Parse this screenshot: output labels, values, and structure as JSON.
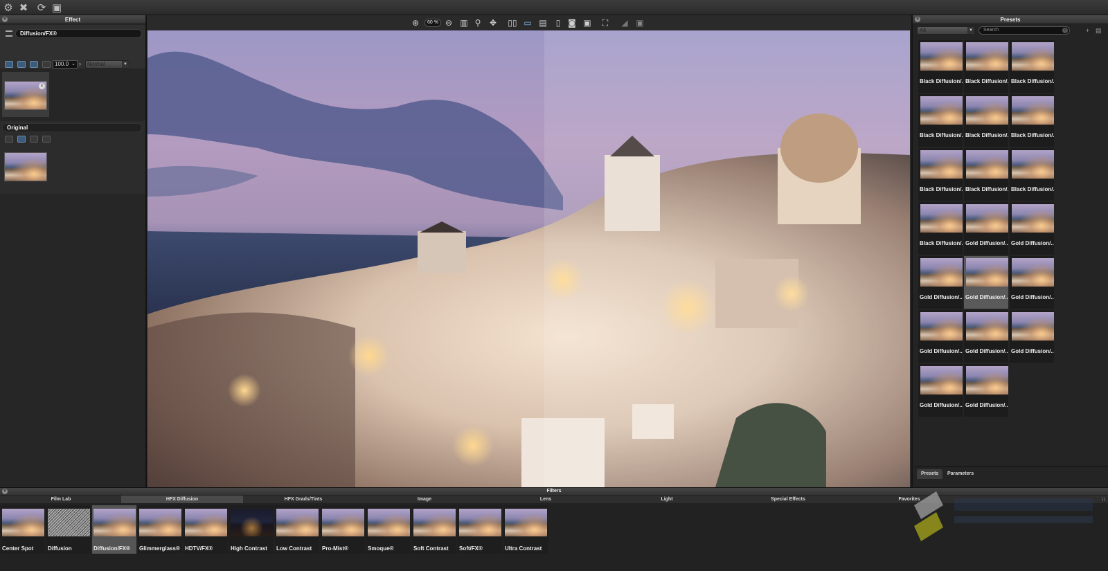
{
  "top_toolbar": {
    "icons": [
      "gear-icon",
      "close-x-icon",
      "refresh-icon",
      "frame-icon"
    ]
  },
  "left_panel": {
    "header": "Effect",
    "effect_layer": {
      "name": "Diffusion/FX®",
      "opacity": "100.0",
      "blend_mode": "Normal"
    },
    "original_layer": {
      "name": "Original"
    }
  },
  "center": {
    "zoom": "60 %",
    "tools": [
      "zoom-in-icon",
      "zoom-out-icon",
      "fit-icon",
      "magnify-icon",
      "pan-icon",
      "split-view-icon",
      "side-by-side-icon",
      "single-view-icon",
      "page-icon",
      "camera-icon",
      "monitor-icon",
      "crop-icon",
      "histogram-icon",
      "mask-icon"
    ]
  },
  "right_panel": {
    "header": "Presets",
    "filter_value": "All",
    "search_placeholder": "Search",
    "presets": [
      "Black Diffusion/...",
      "Black Diffusion/...",
      "Black Diffusion/...",
      "Black Diffusion/...",
      "Black Diffusion/...",
      "Black Diffusion/...",
      "Black Diffusion/...",
      "Black Diffusion/...",
      "Black Diffusion/...",
      "Black Diffusion/...",
      "Gold Diffusion/...",
      "Gold Diffusion/...",
      "Gold Diffusion/...",
      "Gold Diffusion/...",
      "Gold Diffusion/...",
      "Gold Diffusion/...",
      "Gold Diffusion/...",
      "Gold Diffusion/...",
      "Gold Diffusion/...",
      "Gold Diffusion/..."
    ],
    "selected_preset_index": 13,
    "tabs": [
      "Presets",
      "Parameters"
    ]
  },
  "bottom": {
    "header": "Filters",
    "categories": [
      "Film Lab",
      "HFX Diffusion",
      "HFX Grads/Tints",
      "Image",
      "Lens",
      "Light",
      "Special Effects",
      "Favorites"
    ],
    "active_category": "HFX Diffusion",
    "filters": [
      "Center Spot",
      "Diffusion",
      "Diffusion/FX®",
      "Glimmerglass®",
      "HDTV/FX®",
      "High Contrast",
      "Low Contrast",
      "Pro-Mist®",
      "Smoque®",
      "Soft Contrast",
      "Soft/FX®",
      "Ultra Contrast"
    ],
    "selected_filter": "Diffusion/FX®"
  }
}
